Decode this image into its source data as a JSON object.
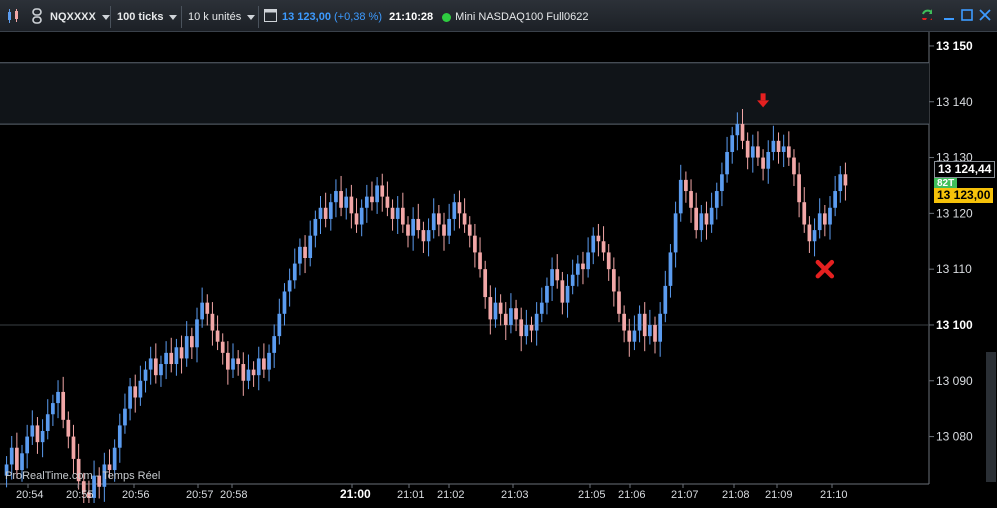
{
  "toolbar": {
    "symbol": "NQXXXX",
    "interval": "100 ticks",
    "units": "10 k unités",
    "last_price": "13 123,00",
    "change": "(+0,38 %)",
    "time": "21:10:28",
    "instrument": "Mini NASDAQ100 Full0622"
  },
  "watermark": "ProRealTime.com - Temps Réel",
  "tags": {
    "price_tag_top": "13 124,44",
    "ticks_tag": "82T",
    "price_tag_current": "13 123,00"
  },
  "colors": {
    "up": "#5b9cf0",
    "down": "#f2a7a7",
    "current_price_bg": "#f6c20a",
    "ticks_tag_bg": "#3fbf5a",
    "arrow": "#e52020",
    "cross": "#e52020"
  },
  "chart_data": {
    "type": "candlestick",
    "y_ticks": [
      "13 150",
      "13 140",
      "13 130",
      "13 120",
      "13 110",
      "13 100",
      "13 090",
      "13 080"
    ],
    "y_tick_values": [
      13150,
      13140,
      13130,
      13120,
      13110,
      13100,
      13090,
      13080
    ],
    "y_major": [
      "13 150",
      "13 100"
    ],
    "ylim": [
      13071.5,
      13152.5
    ],
    "x_ticks": [
      "20:54",
      "20:55",
      "20:56",
      "20:57",
      "20:58",
      "21:00",
      "21:01",
      "21:02",
      "21:03",
      "21:05",
      "21:06",
      "21:07",
      "21:08",
      "21:09",
      "21:10"
    ],
    "x_major": [
      "21:00"
    ],
    "zone": [
      13136,
      13147
    ],
    "horizontal_levels": [
      13100
    ],
    "closes": [
      13075,
      13078,
      13074,
      13077,
      13080,
      13082,
      13079,
      13081,
      13084,
      13086,
      13088,
      13083,
      13080,
      13076,
      13072,
      13070,
      13069,
      13073,
      13071,
      13075,
      13074,
      13078,
      13082,
      13085,
      13089,
      13087,
      13090,
      13092,
      13094,
      13091,
      13093,
      13095,
      13093,
      13096,
      13094,
      13098,
      13096,
      13101,
      13104,
      13102,
      13099,
      13097,
      13095,
      13092,
      13094,
      13093,
      13090,
      13092,
      13091,
      13094,
      13092,
      13095,
      13098,
      13102,
      13106,
      13108,
      13111,
      13114,
      13112,
      13116,
      13119,
      13121,
      13119,
      13122,
      13124,
      13121,
      13123,
      13120,
      13118,
      13121,
      13123,
      13122,
      13125,
      13123,
      13121,
      13119,
      13121,
      13118,
      13116,
      13119,
      13117,
      13115,
      13117,
      13120,
      13118,
      13116,
      13119,
      13122,
      13120,
      13118,
      13116,
      13113,
      13110,
      13105,
      13101,
      13104,
      13102,
      13100,
      13103,
      13101,
      13098,
      13100,
      13099,
      13102,
      13104,
      13107,
      13110,
      13108,
      13104,
      13107,
      13109,
      13111,
      13110,
      13113,
      13116,
      13115,
      13113,
      13110,
      13106,
      13102,
      13099,
      13097,
      13099,
      13102,
      13098,
      13100,
      13097,
      13102,
      13107,
      13113,
      13120,
      13126,
      13124,
      13121,
      13117,
      13120,
      13118,
      13121,
      13124,
      13127,
      13131,
      13134,
      13136,
      13133,
      13130,
      13132,
      13130,
      13128,
      13131,
      13133,
      13131,
      13132,
      13130,
      13127,
      13122,
      13118,
      13115,
      13117,
      13120,
      13118,
      13121,
      13124,
      13127,
      13125
    ],
    "annotations": [
      {
        "type": "arrow-down",
        "x_index": 147,
        "y": 13139
      },
      {
        "type": "cross",
        "x_index": 159,
        "y": 13110
      }
    ]
  }
}
